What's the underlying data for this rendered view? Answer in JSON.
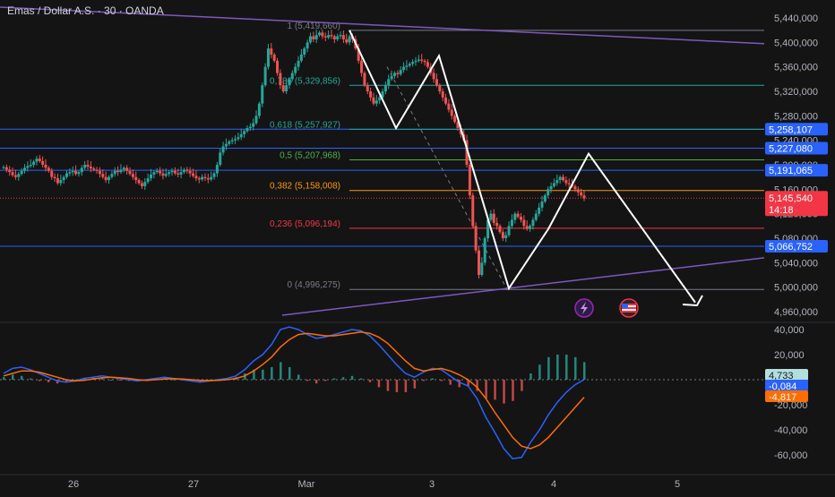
{
  "chart_data": [
    {
      "type": "candlestick",
      "title": "Emas / Dollar A.S. · 30 · OANDA",
      "x_ticks": [
        "26",
        "27",
        "Mar",
        "3",
        "4",
        "5"
      ],
      "ylim": [
        4.95,
        5.44
      ],
      "y_ticks": [
        "5,440,000",
        "5,400,000",
        "5,360,000",
        "5,320,000",
        "5,280,000",
        "5,240,000",
        "5,200,000",
        "5,160,000",
        "5,120,000",
        "5,080,000",
        "5,040,000",
        "5,000,000",
        "4,960,000"
      ],
      "y_tick_values": [
        5.44,
        5.4,
        5.36,
        5.32,
        5.28,
        5.24,
        5.2,
        5.16,
        5.12,
        5.08,
        5.04,
        5.0,
        4.96
      ],
      "series": [
        {
          "values": [
            5.196,
            5.192,
            5.188,
            5.183,
            5.18,
            5.185,
            5.19,
            5.195,
            5.198,
            5.2,
            5.205,
            5.21,
            5.206,
            5.2,
            5.195,
            5.19,
            5.18,
            5.178,
            5.17,
            5.175,
            5.18,
            5.186,
            5.188,
            5.19,
            5.185,
            5.188,
            5.195,
            5.2,
            5.197,
            5.194,
            5.192,
            5.19,
            5.185,
            5.18,
            5.175,
            5.18,
            5.185,
            5.19,
            5.188,
            5.192,
            5.195,
            5.19,
            5.185,
            5.18,
            5.175,
            5.17,
            5.165,
            5.172,
            5.178,
            5.184,
            5.188,
            5.19,
            5.186,
            5.182,
            5.185,
            5.188,
            5.19,
            5.186,
            5.184,
            5.188,
            5.192,
            5.19,
            5.186,
            5.182,
            5.178,
            5.176,
            5.18,
            5.178,
            5.176,
            5.18,
            5.186,
            5.2,
            5.22,
            5.23,
            5.234,
            5.238,
            5.24,
            5.242,
            5.245,
            5.25,
            5.255,
            5.26,
            5.262,
            5.268,
            5.28,
            5.3,
            5.33,
            5.36,
            5.39,
            5.38,
            5.37,
            5.35,
            5.33,
            5.32,
            5.33,
            5.34,
            5.35,
            5.36,
            5.37,
            5.38,
            5.39,
            5.4,
            5.41,
            5.405,
            5.412,
            5.416,
            5.41,
            5.408,
            5.412,
            5.41,
            5.405,
            5.41,
            5.412,
            5.405,
            5.4,
            5.41,
            5.405,
            5.39,
            5.37,
            5.35,
            5.33,
            5.32,
            5.31,
            5.3,
            5.305,
            5.31,
            5.32,
            5.33,
            5.34,
            5.345,
            5.35,
            5.348,
            5.355,
            5.36,
            5.362,
            5.365,
            5.368,
            5.37,
            5.372,
            5.37,
            5.368,
            5.36,
            5.35,
            5.34,
            5.33,
            5.32,
            5.31,
            5.3,
            5.29,
            5.28,
            5.27,
            5.26,
            5.25,
            5.24,
            5.2,
            5.15,
            5.1,
            5.06,
            5.02,
            5.04,
            5.08,
            5.11,
            5.12,
            5.105,
            5.1,
            5.09,
            5.08,
            5.085,
            5.1,
            5.11,
            5.12,
            5.115,
            5.11,
            5.1,
            5.095,
            5.1,
            5.11,
            5.12,
            5.13,
            5.14,
            5.15,
            5.16,
            5.165,
            5.17,
            5.175,
            5.18,
            5.175,
            5.17,
            5.168,
            5.165,
            5.16,
            5.155,
            5.15,
            5.145
          ]
        }
      ],
      "last_price": "5,145,540",
      "countdown": "14:18",
      "price_labels": [
        {
          "value": 5.258107,
          "label": "5,258,107",
          "color": "#2962ff"
        },
        {
          "value": 5.22708,
          "label": "5,227,080",
          "color": "#2962ff"
        },
        {
          "value": 5.191065,
          "label": "5,191,065",
          "color": "#2962ff"
        },
        {
          "value": 5.066752,
          "label": "5,066,752",
          "color": "#2962ff"
        }
      ],
      "fibonacci": [
        {
          "level": 1,
          "label": "1 (5,419,660)",
          "value": 5.41966,
          "color": "#787b86"
        },
        {
          "level": 0.786,
          "label": "0,786 (5,329,856)",
          "value": 5.329856,
          "color": "#26a69a"
        },
        {
          "level": 0.618,
          "label": "0,618 (5,257,927)",
          "value": 5.257927,
          "color": "#26a69a"
        },
        {
          "level": 0.5,
          "label": "0,5 (5,207,968)",
          "value": 5.207968,
          "color": "#4caf50"
        },
        {
          "level": 0.382,
          "label": "0,382 (5,158,008)",
          "value": 5.158008,
          "color": "#ff9800"
        },
        {
          "level": 0.236,
          "label": "0,236 (5,096,194)",
          "value": 5.096194,
          "color": "#f23645"
        },
        {
          "level": 0,
          "label": "0 (4,996,275)",
          "value": 4.996275,
          "color": "#787b86"
        }
      ],
      "colors": {
        "up": "#26a69a",
        "down": "#ef5350",
        "trendline": "#7e57c2",
        "horizontal": "#2962ff",
        "projection": "#ffffff",
        "last_price": "#f23645"
      }
    },
    {
      "type": "macd",
      "ylim": [
        -70000,
        45000
      ],
      "y_ticks": [
        "40,000",
        "20,000",
        "-20,000",
        "-40,000",
        "-60,000"
      ],
      "y_tick_values": [
        40000,
        20000,
        -20000,
        -40000,
        -60000
      ],
      "labels": {
        "histogram": "4,733",
        "macd": "-0,084",
        "signal": "-4,817"
      },
      "series": [
        {
          "values": [
            5000,
            9000,
            10000,
            8000,
            5000,
            2000,
            -1000,
            -2000,
            -1000,
            1000,
            2000,
            3000,
            2000,
            1000,
            0,
            -1000,
            0,
            1000,
            2000,
            1000,
            0,
            -1000,
            -2000,
            -1000,
            0,
            1000,
            3000,
            8000,
            15000,
            20000,
            28000,
            40000,
            42000,
            40000,
            36000,
            33000,
            34000,
            36000,
            38000,
            40000,
            39000,
            35000,
            28000,
            20000,
            12000,
            5000,
            2000,
            6000,
            9000,
            8000,
            3000,
            -2000,
            -5000,
            -15000,
            -30000,
            -42000,
            -55000,
            -63000,
            -62000,
            -50000,
            -40000,
            -28000,
            -18000,
            -10000,
            -4000,
            0
          ]
        },
        {
          "values": [
            3000,
            5000,
            7000,
            7000,
            6000,
            4000,
            2000,
            0,
            -1000,
            -500,
            500,
            1500,
            2000,
            1500,
            1000,
            0,
            -500,
            0,
            500,
            800,
            500,
            0,
            -500,
            -800,
            -500,
            0,
            1000,
            3000,
            7000,
            12000,
            18000,
            26000,
            32000,
            36000,
            37000,
            36000,
            35000,
            35000,
            36000,
            37000,
            38000,
            37000,
            34000,
            29000,
            22000,
            15000,
            9000,
            7000,
            8000,
            9000,
            7000,
            4000,
            0,
            -6000,
            -15000,
            -26000,
            -36000,
            -46000,
            -53000,
            -55000,
            -52000,
            -46000,
            -38000,
            -30000,
            -22000,
            -14000
          ]
        },
        {
          "values": [
            2000,
            4000,
            3000,
            1000,
            -1000,
            -2000,
            -3000,
            -2000,
            0,
            1500,
            1500,
            1500,
            0,
            -500,
            -1000,
            -1000,
            500,
            1000,
            1500,
            200,
            -500,
            -1000,
            -1500,
            -200,
            500,
            1000,
            2000,
            5000,
            8000,
            8000,
            10000,
            14000,
            10000,
            4000,
            -1000,
            -3000,
            -1000,
            1000,
            2000,
            3000,
            1000,
            -2000,
            -6000,
            -9000,
            -10000,
            -10000,
            -7000,
            -1000,
            1000,
            -1000,
            -4000,
            -6000,
            -5000,
            -9000,
            -15000,
            -16000,
            -19000,
            -17000,
            -9000,
            5000,
            12000,
            18000,
            20000,
            20000,
            18000,
            14000
          ]
        }
      ]
    }
  ]
}
